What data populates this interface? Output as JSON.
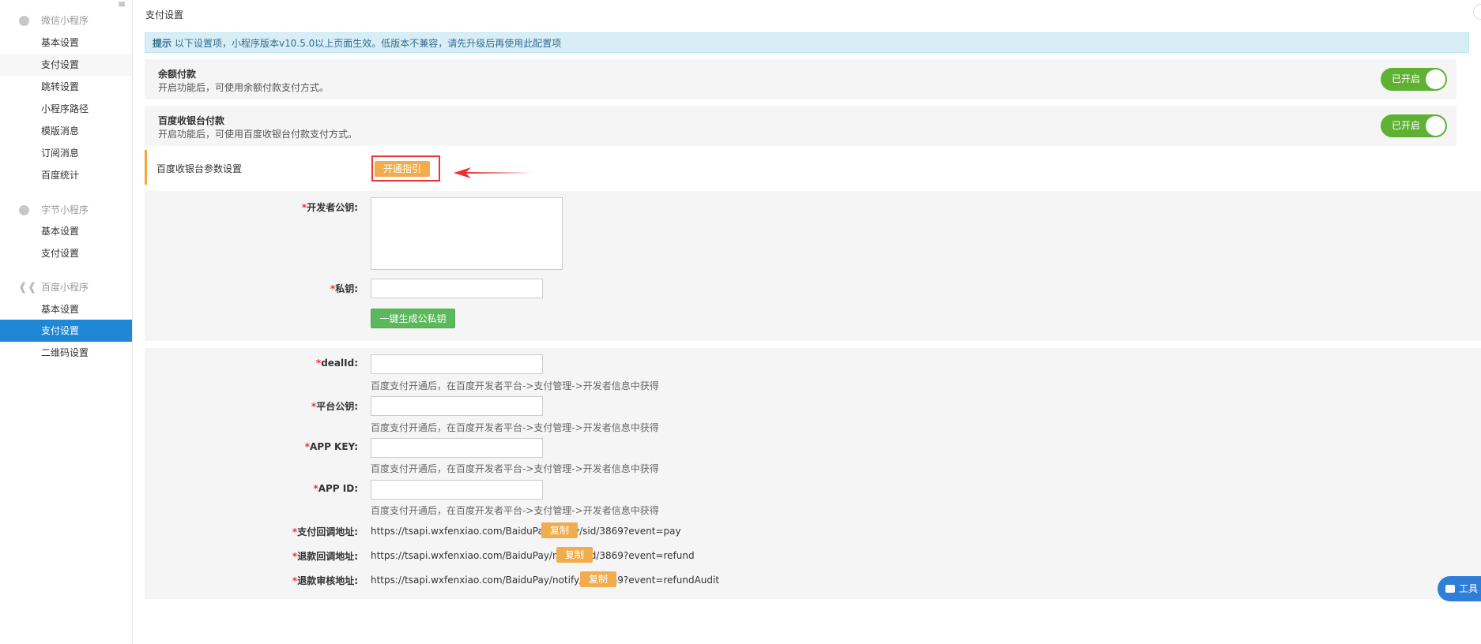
{
  "sidebar": {
    "groups": [
      {
        "label": "微信小程序",
        "items": [
          "基本设置",
          "支付设置",
          "跳转设置",
          "小程序路径",
          "模版消息",
          "订阅消息",
          "百度统计"
        ]
      },
      {
        "label": "字节小程序",
        "items": [
          "基本设置",
          "支付设置"
        ]
      },
      {
        "label": "百度小程序",
        "items": [
          "基本设置",
          "支付设置",
          "二维码设置"
        ]
      }
    ],
    "active_item": "百度小程序/支付设置"
  },
  "page": {
    "title": "支付设置",
    "tip": {
      "prefix": "提示",
      "text": "以下设置项，小程序版本v10.5.0以上页面生效。低版本不兼容，请先升级后再使用此配置项"
    }
  },
  "settings": [
    {
      "title": "余额付款",
      "desc": "开启功能后，可使用余额付款支付方式。",
      "toggle_label": "已开启",
      "enabled": true
    },
    {
      "title": "百度收银台付款",
      "desc": "开启功能后，可使用百度收银台付款支付方式。",
      "toggle_label": "已开启",
      "enabled": true
    }
  ],
  "params": {
    "label": "百度收银台参数设置",
    "guide_button": "开通指引"
  },
  "keys": {
    "public_key_label": "开发者公钥:",
    "public_key_value": "",
    "private_key_label": "私钥:",
    "private_key_value": "",
    "generate_button": "一键生成公私钥"
  },
  "fields": [
    {
      "label": "dealId:",
      "value": "",
      "help": "百度支付开通后，在百度开发者平台->支付管理->开发者信息中获得"
    },
    {
      "label": "平台公钥:",
      "value": "",
      "help": "百度支付开通后，在百度开发者平台->支付管理->开发者信息中获得"
    },
    {
      "label": "APP KEY:",
      "value": "",
      "help": "百度支付开通后，在百度开发者平台->支付管理->开发者信息中获得"
    },
    {
      "label": "APP ID:",
      "value": "",
      "help": "百度支付开通后，在百度开发者平台->支付管理->开发者信息中获得"
    }
  ],
  "urls": [
    {
      "label": "支付回调地址:",
      "url": "https://tsapi.wxfenxiao.com/BaiduPay/notify/sid/3869?event=pay",
      "copy": "复制"
    },
    {
      "label": "退款回调地址:",
      "url": "https://tsapi.wxfenxiao.com/BaiduPay/notify/sid/3869?event=refund",
      "copy": "复制"
    },
    {
      "label": "退款审核地址:",
      "url": "https://tsapi.wxfenxiao.com/BaiduPay/notify/sid/3869?event=refundAudit",
      "copy": "复制"
    }
  ],
  "required_mark": "*",
  "toolbox": {
    "label": "工具箱"
  },
  "colors": {
    "active": "#1e88d6",
    "toggle_on": "#5fb133",
    "warning": "#f0ad4e",
    "success": "#5cb85c",
    "tip_bg": "#d9edf7",
    "highlight": "#e33333"
  }
}
